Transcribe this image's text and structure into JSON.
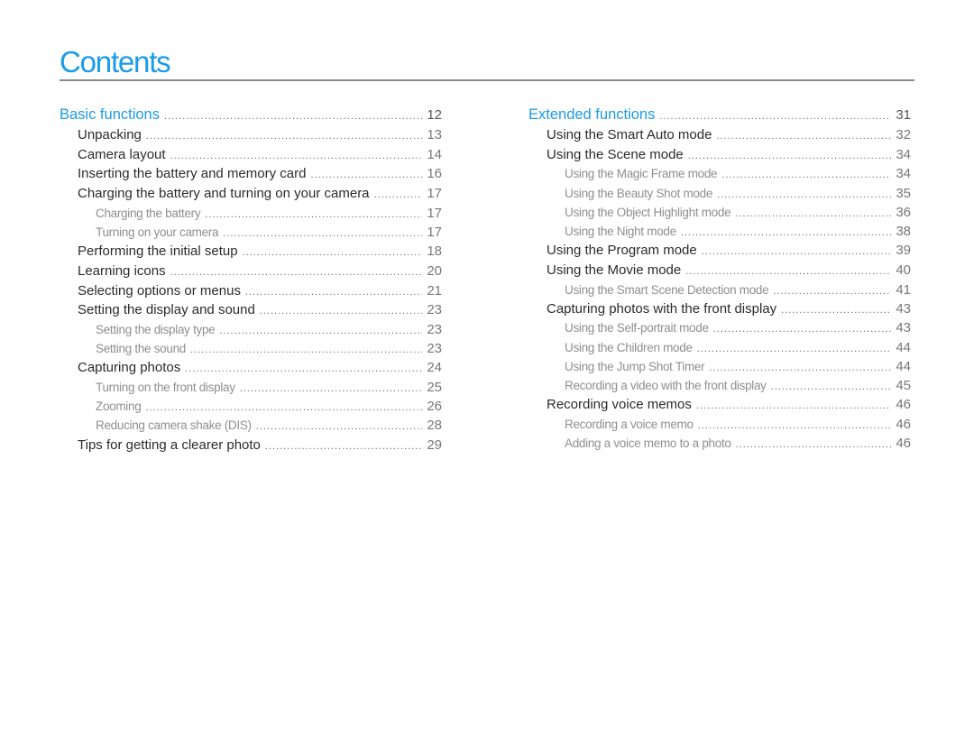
{
  "title": "Contents",
  "colors": {
    "accent": "#1a9bea",
    "rule": "#8a8a8a"
  },
  "columns": [
    {
      "entries": [
        {
          "level": 0,
          "label": "Basic functions",
          "page": "12"
        },
        {
          "level": 1,
          "label": "Unpacking",
          "page": "13"
        },
        {
          "level": 1,
          "label": "Camera layout",
          "page": "14"
        },
        {
          "level": 1,
          "label": "Inserting the battery and memory card",
          "page": "16"
        },
        {
          "level": 1,
          "label": "Charging the battery and turning on your camera",
          "page": "17"
        },
        {
          "level": 2,
          "label": "Charging the battery",
          "page": "17"
        },
        {
          "level": 2,
          "label": "Turning on your camera",
          "page": "17"
        },
        {
          "level": 1,
          "label": "Performing the initial setup",
          "page": "18"
        },
        {
          "level": 1,
          "label": "Learning icons",
          "page": "20"
        },
        {
          "level": 1,
          "label": "Selecting options or menus",
          "page": "21"
        },
        {
          "level": 1,
          "label": "Setting the display and sound",
          "page": "23"
        },
        {
          "level": 2,
          "label": "Setting the display type",
          "page": "23"
        },
        {
          "level": 2,
          "label": "Setting the sound",
          "page": "23"
        },
        {
          "level": 1,
          "label": "Capturing photos",
          "page": "24"
        },
        {
          "level": 2,
          "label": "Turning on the front display",
          "page": "25"
        },
        {
          "level": 2,
          "label": "Zooming",
          "page": "26"
        },
        {
          "level": 2,
          "label": "Reducing camera shake (DIS)",
          "page": "28"
        },
        {
          "level": 1,
          "label": "Tips for getting a clearer photo",
          "page": "29"
        }
      ]
    },
    {
      "entries": [
        {
          "level": 0,
          "label": "Extended functions",
          "page": "31"
        },
        {
          "level": 1,
          "label": "Using the Smart Auto mode",
          "page": "32"
        },
        {
          "level": 1,
          "label": "Using the Scene mode",
          "page": "34"
        },
        {
          "level": 2,
          "label": "Using the Magic Frame mode",
          "page": "34"
        },
        {
          "level": 2,
          "label": "Using the Beauty Shot mode",
          "page": "35"
        },
        {
          "level": 2,
          "label": "Using the Object Highlight mode",
          "page": "36"
        },
        {
          "level": 2,
          "label": "Using the Night mode",
          "page": "38"
        },
        {
          "level": 1,
          "label": "Using the Program mode",
          "page": "39"
        },
        {
          "level": 1,
          "label": "Using the Movie mode",
          "page": "40"
        },
        {
          "level": 2,
          "label": "Using the Smart Scene Detection mode",
          "page": "41"
        },
        {
          "level": 1,
          "label": "Capturing photos with the front display",
          "page": "43"
        },
        {
          "level": 2,
          "label": "Using the Self-portrait mode",
          "page": "43"
        },
        {
          "level": 2,
          "label": "Using the Children mode",
          "page": "44"
        },
        {
          "level": 2,
          "label": "Using the Jump Shot Timer",
          "page": "44"
        },
        {
          "level": 2,
          "label": "Recording a video with the front display",
          "page": "45"
        },
        {
          "level": 1,
          "label": "Recording voice memos",
          "page": "46"
        },
        {
          "level": 2,
          "label": "Recording a voice memo",
          "page": "46"
        },
        {
          "level": 2,
          "label": "Adding a voice memo to a photo",
          "page": "46"
        }
      ]
    }
  ]
}
